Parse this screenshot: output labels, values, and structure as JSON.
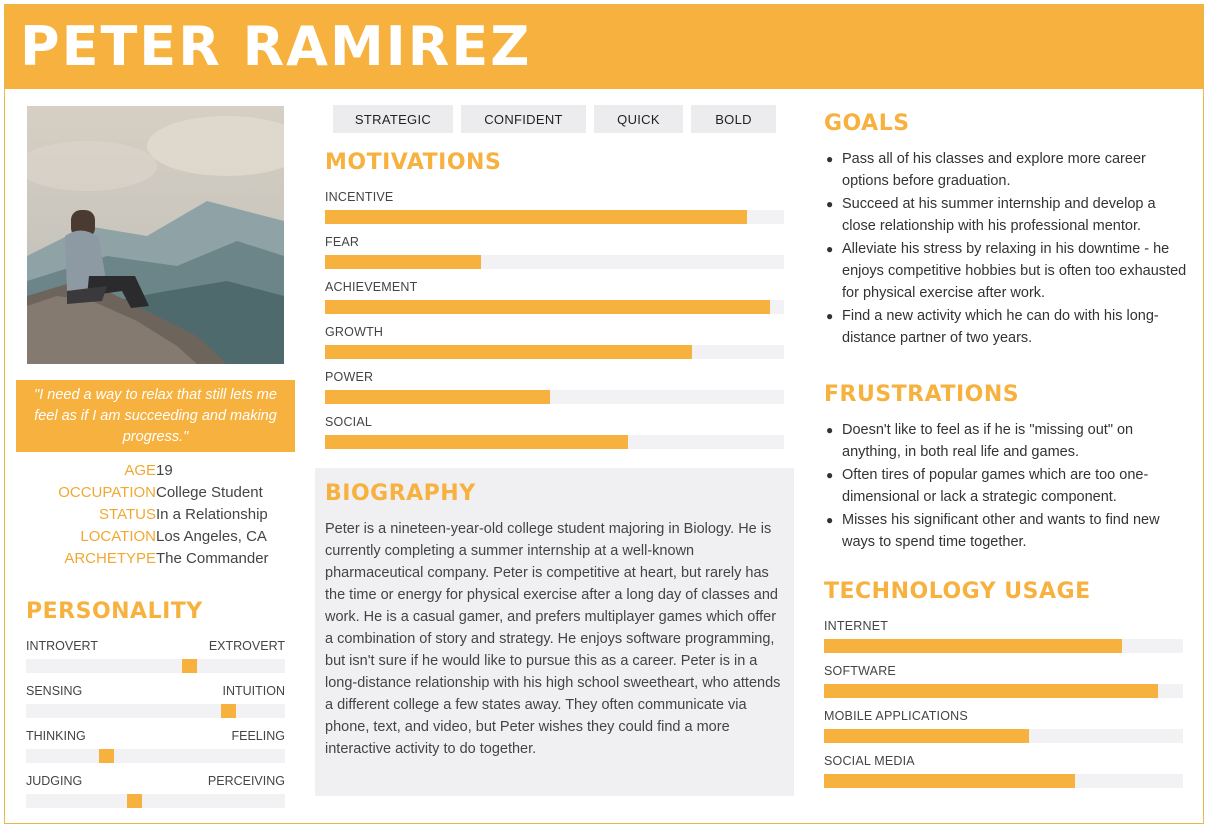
{
  "name": "PETER RAMIREZ",
  "quote": "\"I need a way to relax that still lets me feel as if I am succeeding and making progress.\"",
  "info": [
    {
      "label": "AGE",
      "value": "19"
    },
    {
      "label": "OCCUPATION",
      "value": "College Student"
    },
    {
      "label": "STATUS",
      "value": "In a Relationship"
    },
    {
      "label": "LOCATION",
      "value": "Los Angeles, CA"
    },
    {
      "label": "ARCHETYPE",
      "value": "The Commander"
    }
  ],
  "personality": {
    "title": "PERSONALITY",
    "sliders": [
      {
        "left": "INTROVERT",
        "right": "EXTROVERT",
        "value": 0.63
      },
      {
        "left": "SENSING",
        "right": "INTUITION",
        "value": 0.78
      },
      {
        "left": "THINKING",
        "right": "FEELING",
        "value": 0.31
      },
      {
        "left": "JUDGING",
        "right": "PERCEIVING",
        "value": 0.42
      }
    ]
  },
  "traits": [
    "STRATEGIC",
    "CONFIDENT",
    "QUICK",
    "BOLD"
  ],
  "motivations": {
    "title": "MOTIVATIONS",
    "bars": [
      {
        "label": "INCENTIVE",
        "value": 0.92
      },
      {
        "label": "FEAR",
        "value": 0.34
      },
      {
        "label": "ACHIEVEMENT",
        "value": 0.97
      },
      {
        "label": "GROWTH",
        "value": 0.8
      },
      {
        "label": "POWER",
        "value": 0.49
      },
      {
        "label": "SOCIAL",
        "value": 0.66
      }
    ]
  },
  "biography": {
    "title": "BIOGRAPHY",
    "text": "Peter is a nineteen-year-old college student majoring in Biology. He is currently completing a summer internship at a well-known pharmaceutical company. Peter is competitive at heart, but rarely has the time or energy for physical exercise after a long day of classes and work. He is a casual gamer, and prefers multiplayer games which offer a combination of story and strategy. He enjoys software programming, but isn't sure if he would like to pursue this as a career. Peter is in a long-distance relationship with his high school sweetheart, who attends a different college a few states away. They often communicate via phone, text, and video, but Peter wishes they could find a more interactive activity to do together."
  },
  "goals": {
    "title": "GOALS",
    "items": [
      "Pass all of his classes and explore more career options before graduation.",
      "Succeed at his summer internship and develop a close relationship with his professional mentor.",
      "Alleviate his stress by relaxing in his downtime - he enjoys competitive hobbies but is often too exhausted for physical exercise after work.",
      "Find a new activity which he can do with his long-distance partner of two years."
    ]
  },
  "frustrations": {
    "title": "FRUSTRATIONS",
    "items": [
      "Doesn't like to feel as if he is \"missing out\" on anything, in both real life and games.",
      "Often tires of popular games which are too one-dimensional or lack a strategic component.",
      "Misses his significant other and wants to find new ways to spend time together."
    ]
  },
  "technology": {
    "title": "TECHNOLOGY USAGE",
    "bars": [
      {
        "label": "INTERNET",
        "value": 0.83
      },
      {
        "label": "SOFTWARE",
        "value": 0.93
      },
      {
        "label": "MOBILE APPLICATIONS",
        "value": 0.57
      },
      {
        "label": "SOCIAL MEDIA",
        "value": 0.7
      }
    ]
  },
  "colors": {
    "accent": "#f7b13f",
    "track": "#f2f2f4",
    "panel": "#f0f0f2"
  }
}
